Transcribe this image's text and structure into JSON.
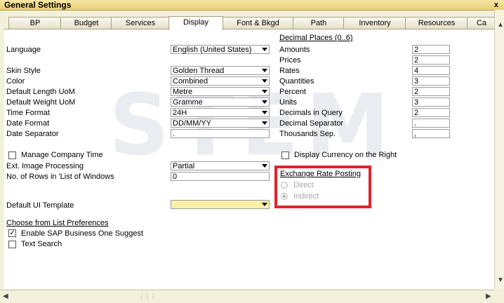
{
  "window": {
    "title": "General Settings",
    "close_glyph": "x"
  },
  "tabs": [
    "BP",
    "Budget",
    "Services",
    "Display",
    "Font & Bkgd",
    "Path",
    "Inventory",
    "Resources",
    "Ca"
  ],
  "active_tab": "Display",
  "left": {
    "language_label": "Language",
    "language_value": "English (United States)",
    "skin_label": "Skin Style",
    "skin_value": "Golden Thread",
    "color_label": "Color",
    "color_value": "Combined",
    "length_label": "Default Length UoM",
    "length_value": "Metre",
    "weight_label": "Default Weight UoM",
    "weight_value": "Gramme",
    "time_label": "Time Format",
    "time_value": "24H",
    "date_format_label": "Date Format",
    "date_format_value": "DD/MM/YY",
    "date_sep_label": "Date Separator",
    "date_sep_value": ".",
    "manage_time_label": "Manage Company Time",
    "ext_image_label": "Ext. Image Processing",
    "ext_image_value": "Partial",
    "rows_label": "No. of Rows in 'List of Windows",
    "rows_value": "0",
    "ui_template_label": "Default UI Template",
    "ui_template_value": "",
    "cfl_header": "Choose from List Preferences",
    "enable_suggest_label": "Enable SAP Business One Suggest",
    "text_search_label": "Text Search"
  },
  "right": {
    "decimal_header": "Decimal Places  (0..6)",
    "amounts_label": "Amounts",
    "amounts_value": "2",
    "prices_label": "Prices",
    "prices_value": "2",
    "rates_label": "Rates",
    "rates_value": "4",
    "quantities_label": "Quantities",
    "quantities_value": "3",
    "percent_label": "Percent",
    "percent_value": "2",
    "units_label": "Units",
    "units_value": "3",
    "dec_query_label": "Decimals in Query",
    "dec_query_value": "2",
    "dec_sep_label": "Decimal Separator",
    "dec_sep_value": ".",
    "thousands_label": "Thousands Sep.",
    "thousands_value": ",",
    "display_currency_label": "Display Currency on the Right",
    "exchange_header": "Exchange Rate Posting",
    "direct_label": "Direct",
    "indirect_label": "Indirect",
    "selected_rate": "Indirect"
  },
  "checkboxes": {
    "manage_time": false,
    "enable_suggest": true,
    "text_search": false,
    "display_currency": false
  },
  "watermark": "STEM",
  "colors": {
    "highlight": "#e0232b",
    "ui_template_bg": "#fbf0a8",
    "title_bg": "#ecd580"
  }
}
